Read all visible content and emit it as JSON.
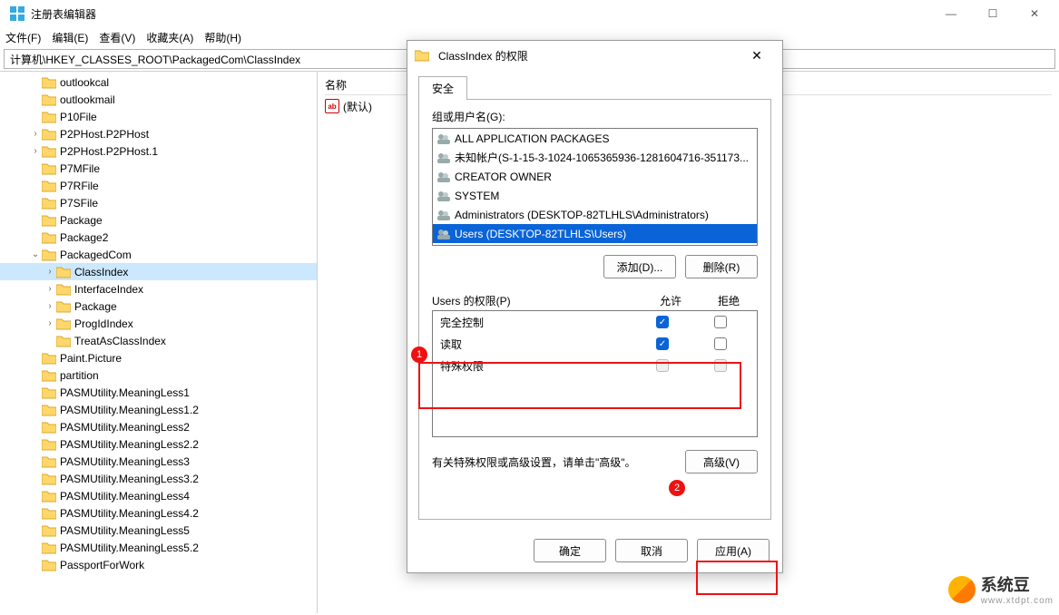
{
  "window": {
    "title": "注册表编辑器",
    "min": "—",
    "max": "☐",
    "close": "✕"
  },
  "menu": [
    "文件(F)",
    "编辑(E)",
    "查看(V)",
    "收藏夹(A)",
    "帮助(H)"
  ],
  "address": "计算机\\HKEY_CLASSES_ROOT\\PackagedCom\\ClassIndex",
  "tree": [
    {
      "indent": 2,
      "chev": "",
      "label": "outlookcal"
    },
    {
      "indent": 2,
      "chev": "",
      "label": "outlookmail"
    },
    {
      "indent": 2,
      "chev": "",
      "label": "P10File"
    },
    {
      "indent": 2,
      "chev": ">",
      "label": "P2PHost.P2PHost"
    },
    {
      "indent": 2,
      "chev": ">",
      "label": "P2PHost.P2PHost.1"
    },
    {
      "indent": 2,
      "chev": "",
      "label": "P7MFile"
    },
    {
      "indent": 2,
      "chev": "",
      "label": "P7RFile"
    },
    {
      "indent": 2,
      "chev": "",
      "label": "P7SFile"
    },
    {
      "indent": 2,
      "chev": "",
      "label": "Package"
    },
    {
      "indent": 2,
      "chev": "",
      "label": "Package2"
    },
    {
      "indent": 2,
      "chev": "v",
      "label": "PackagedCom"
    },
    {
      "indent": 3,
      "chev": ">",
      "label": "ClassIndex",
      "selected": true
    },
    {
      "indent": 3,
      "chev": ">",
      "label": "InterfaceIndex"
    },
    {
      "indent": 3,
      "chev": ">",
      "label": "Package"
    },
    {
      "indent": 3,
      "chev": ">",
      "label": "ProgIdIndex"
    },
    {
      "indent": 3,
      "chev": "",
      "label": "TreatAsClassIndex"
    },
    {
      "indent": 2,
      "chev": "",
      "label": "Paint.Picture"
    },
    {
      "indent": 2,
      "chev": "",
      "label": "partition"
    },
    {
      "indent": 2,
      "chev": "",
      "label": "PASMUtility.MeaningLess1"
    },
    {
      "indent": 2,
      "chev": "",
      "label": "PASMUtility.MeaningLess1.2"
    },
    {
      "indent": 2,
      "chev": "",
      "label": "PASMUtility.MeaningLess2"
    },
    {
      "indent": 2,
      "chev": "",
      "label": "PASMUtility.MeaningLess2.2"
    },
    {
      "indent": 2,
      "chev": "",
      "label": "PASMUtility.MeaningLess3"
    },
    {
      "indent": 2,
      "chev": "",
      "label": "PASMUtility.MeaningLess3.2"
    },
    {
      "indent": 2,
      "chev": "",
      "label": "PASMUtility.MeaningLess4"
    },
    {
      "indent": 2,
      "chev": "",
      "label": "PASMUtility.MeaningLess4.2"
    },
    {
      "indent": 2,
      "chev": "",
      "label": "PASMUtility.MeaningLess5"
    },
    {
      "indent": 2,
      "chev": "",
      "label": "PASMUtility.MeaningLess5.2"
    },
    {
      "indent": 2,
      "chev": "",
      "label": "PassportForWork"
    }
  ],
  "value_header": "名称",
  "value_default": "(默认)",
  "dialog": {
    "title": "ClassIndex 的权限",
    "tab": "安全",
    "group_label": "组或用户名(G):",
    "groups": [
      "ALL APPLICATION PACKAGES",
      "未知帐户(S-1-15-3-1024-1065365936-1281604716-351173...",
      "CREATOR OWNER",
      "SYSTEM",
      "Administrators (DESKTOP-82TLHLS\\Administrators)",
      "Users (DESKTOP-82TLHLS\\Users)"
    ],
    "add_btn": "添加(D)...",
    "remove_btn": "删除(R)",
    "perm_label": "Users 的权限(P)",
    "allow": "允许",
    "deny": "拒绝",
    "perms": [
      {
        "name": "完全控制",
        "allow": true,
        "deny": false
      },
      {
        "name": "读取",
        "allow": true,
        "deny": false
      },
      {
        "name": "特殊权限",
        "allow": false,
        "deny": false,
        "disabled": true
      }
    ],
    "adv_text": "有关特殊权限或高级设置，请单击\"高级\"。",
    "adv_btn": "高级(V)",
    "ok": "确定",
    "cancel": "取消",
    "apply": "应用(A)"
  },
  "badges": {
    "b1": "1",
    "b2": "2"
  },
  "watermark": {
    "brand": "系统豆",
    "url": "www.xtdpt.com"
  }
}
